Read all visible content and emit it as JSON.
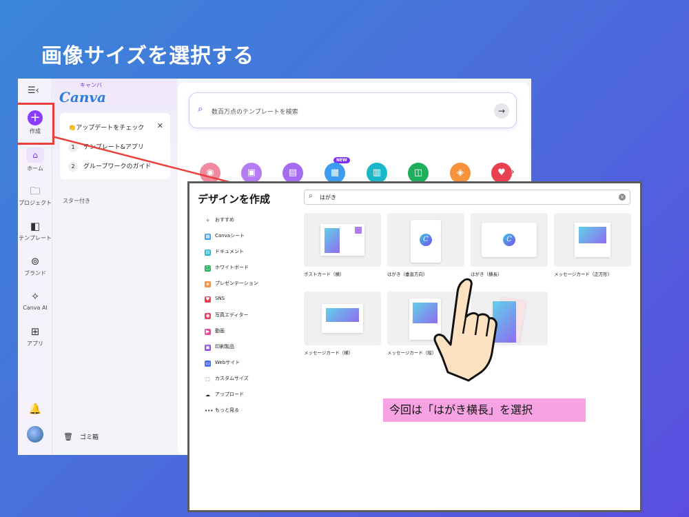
{
  "slide_title": "画像サイズを選択する",
  "sidebar": {
    "create_label": "作成",
    "items": [
      {
        "label": "ホーム",
        "icon": "home-icon"
      },
      {
        "label": "プロジェクト",
        "icon": "folder-icon"
      },
      {
        "label": "テンプレート",
        "icon": "template-icon"
      },
      {
        "label": "ブランド",
        "icon": "brand-icon"
      },
      {
        "label": "Canva AI",
        "icon": "sparkle-icon"
      },
      {
        "label": "アプリ",
        "icon": "apps-icon"
      }
    ]
  },
  "logo": {
    "kana": "キャンバ",
    "word": "Canva"
  },
  "update_card": {
    "heading": "アップデートをチェック",
    "items": [
      {
        "num": "1",
        "label": "テンプレート&アプリ"
      },
      {
        "num": "2",
        "label": "グループワークのガイド"
      }
    ]
  },
  "starred_label": "スター付き",
  "trash_label": "ゴミ箱",
  "search": {
    "placeholder": "数百万点のテンプレートを検索"
  },
  "new_badge": "NEW",
  "dialog": {
    "title": "デザインを作成",
    "search_value": "はがき",
    "nav": [
      {
        "label": "おすすめ",
        "color": "#222222"
      },
      {
        "label": "Canvaシート",
        "color": "#3b9cf0"
      },
      {
        "label": "ドキュメント",
        "color": "#1bb6c8"
      },
      {
        "label": "ホワイトボード",
        "color": "#1fae5b"
      },
      {
        "label": "プレゼンテーション",
        "color": "#f5923b"
      },
      {
        "label": "SNS",
        "color": "#e8404f"
      },
      {
        "label": "写真エディター",
        "color": "#e8405f"
      },
      {
        "label": "動画",
        "color": "#e94b9a"
      },
      {
        "label": "印刷製品",
        "color": "#8e44e8"
      },
      {
        "label": "Webサイト",
        "color": "#4a6cf0"
      },
      {
        "label": "カスタムサイズ",
        "color": "#222222"
      },
      {
        "label": "アップロード",
        "color": "#222222"
      },
      {
        "label": "もっと見る",
        "color": "#222222"
      }
    ],
    "templates": [
      {
        "label": "ポストカード（横）"
      },
      {
        "label": "はがき（垂直方向）"
      },
      {
        "label": "はがき（横長）"
      },
      {
        "label": "メッセージカード（正方形）"
      },
      {
        "label": "メッセージカード（横）"
      },
      {
        "label": "メッセージカード（縦）"
      },
      {
        "label": "）"
      }
    ]
  },
  "caption": "今回は「はがき横長」を選択",
  "colors": {
    "accent": "#8b3dff",
    "highlight": "#e8403a",
    "caption_bg": "#f7a3e3"
  }
}
